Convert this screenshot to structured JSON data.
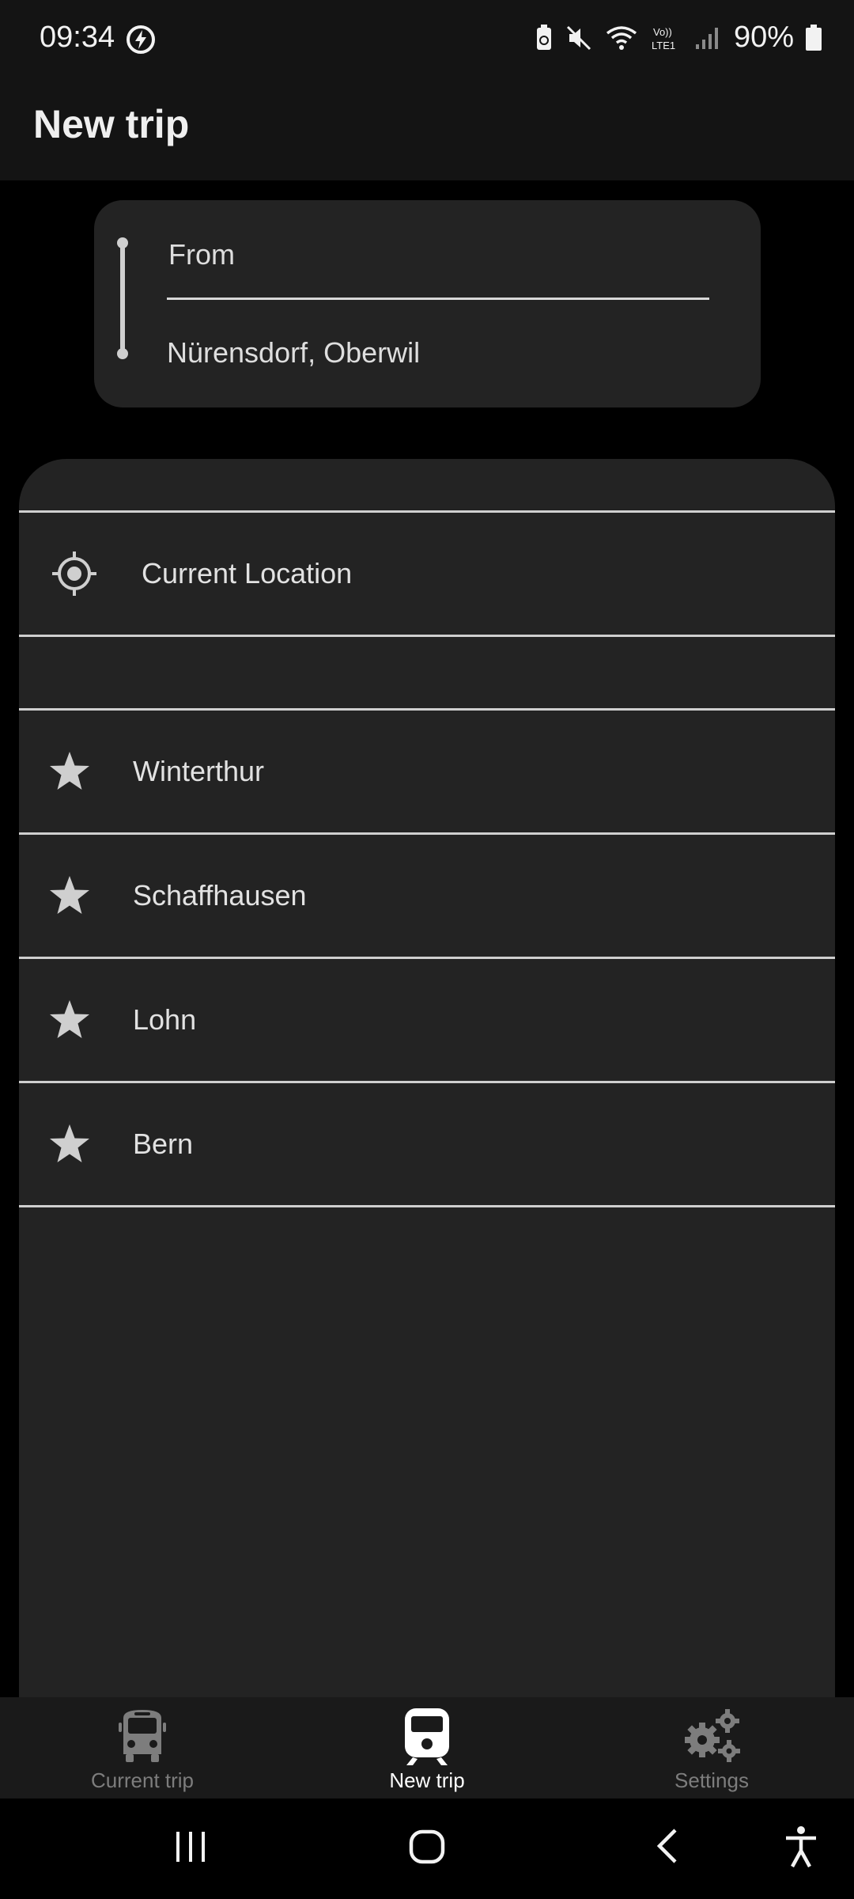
{
  "status_bar": {
    "time": "09:34",
    "battery_percent": "90%",
    "icons": [
      "flash-circle-icon",
      "battery-saver-icon",
      "mute-icon",
      "wifi-icon",
      "volte-lte-icon",
      "signal-icon",
      "battery-icon"
    ]
  },
  "app_bar": {
    "title": "New trip"
  },
  "route": {
    "from_placeholder": "From",
    "to_value": "Nürensdorf, Oberwil"
  },
  "suggestions": {
    "current_location_label": "Current Location",
    "favorites": [
      {
        "label": "Winterthur",
        "icon": "star-icon"
      },
      {
        "label": "Schaffhausen",
        "icon": "star-icon"
      },
      {
        "label": "Lohn",
        "icon": "star-icon"
      },
      {
        "label": "Bern",
        "icon": "star-icon"
      }
    ]
  },
  "bottom_nav": {
    "items": [
      {
        "label": "Current trip",
        "icon": "bus-icon",
        "active": false
      },
      {
        "label": "New trip",
        "icon": "train-icon",
        "active": true
      },
      {
        "label": "Settings",
        "icon": "gears-icon",
        "active": false
      }
    ]
  },
  "colors": {
    "background": "#000000",
    "surface": "#232323",
    "bar": "#141414",
    "divider": "#cfcfcf",
    "text": "#e2e2e2",
    "nav_inactive": "#7d7d7d",
    "nav_active": "#ffffff"
  }
}
